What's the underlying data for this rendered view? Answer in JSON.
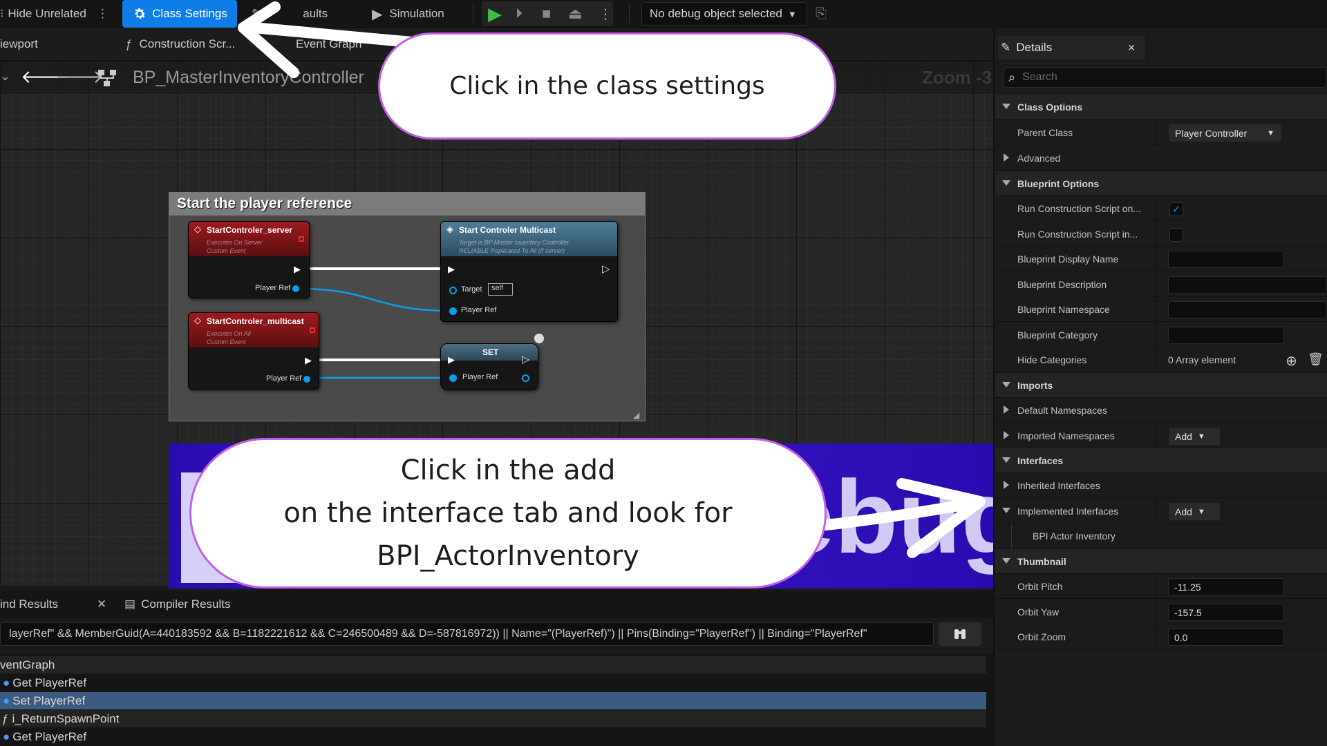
{
  "toolbar": {
    "hide_unrelated": "Hide Unrelated",
    "class_settings": "Class Settings",
    "class_defaults": "aults",
    "simulation": "Simulation",
    "debug_object": "No debug object selected"
  },
  "tabs": {
    "viewport": "iewport",
    "construction_script": "Construction Scr...",
    "event_graph": "Event Graph"
  },
  "graph": {
    "blueprint_name": "BP_MasterInventoryController",
    "zoom": "Zoom -3",
    "comment": "Start the player reference",
    "nodes": {
      "server": {
        "title": "StartControler_server",
        "sub1": "Executes On Server",
        "sub2": "Custom Event",
        "pin": "Player Ref"
      },
      "multicast_event": {
        "title": "StartControler_multicast",
        "sub1": "Executes On All",
        "sub2": "Custom Event",
        "pin": "Player Ref"
      },
      "multicast_call": {
        "title": "Start Controler Multicast",
        "sub1": "Target is BP Master Inventory Controller",
        "sub2": "RELIABLE Replicated To All (if server)",
        "target_label": "Target",
        "target_value": "self",
        "pin": "Player Ref"
      },
      "set": {
        "title": "SET",
        "pin": "Player Ref"
      }
    }
  },
  "callouts": {
    "top": "Click in the class settings",
    "bottom_line1": "Click in the add",
    "bottom_line2": "on the interface tab and look for",
    "bottom_line3": "BPI_ActorInventory"
  },
  "bottom_panel": {
    "find_results": "ind Results",
    "compiler_results": "Compiler Results",
    "search_query": "layerRef\" && MemberGuid(A=440183592 && B=1182221612 && C=246500489 && D=-587816972)) || Name=\"(PlayerRef)\") || Pins(Binding=\"PlayerRef\") || Binding=\"PlayerRef\"",
    "results": [
      {
        "icon": "",
        "label": "ventGraph"
      },
      {
        "icon": "variable-icon",
        "label": "Get PlayerRef"
      },
      {
        "icon": "variable-icon",
        "label": "Set PlayerRef"
      },
      {
        "icon": "function-icon",
        "label": "i_ReturnSpawnPoint"
      },
      {
        "icon": "variable-icon",
        "label": "Get PlayerRef"
      }
    ]
  },
  "details": {
    "tab_label": "Details",
    "search_placeholder": "Search",
    "class_options": "Class Options",
    "parent_class_label": "Parent Class",
    "parent_class_value": "Player Controller",
    "advanced": "Advanced",
    "blueprint_options": "Blueprint Options",
    "run_cs_on_drag": "Run Construction Script on...",
    "run_cs_in_seq": "Run Construction Script in...",
    "bp_display_name": "Blueprint Display Name",
    "bp_description": "Blueprint Description",
    "bp_namespace": "Blueprint Namespace",
    "bp_category": "Blueprint Category",
    "hide_categories": "Hide Categories",
    "hide_categories_value": "0 Array element",
    "imports": "Imports",
    "default_namespaces": "Default Namespaces",
    "imported_namespaces": "Imported Namespaces",
    "add": "Add",
    "interfaces": "Interfaces",
    "inherited_interfaces": "Inherited Interfaces",
    "implemented_interfaces": "Implemented Interfaces",
    "bpi_actor_inventory": "BPI Actor Inventory",
    "thumbnail": "Thumbnail",
    "orbit_pitch": "Orbit Pitch",
    "orbit_pitch_value": "-11.25",
    "orbit_yaw": "Orbit Yaw",
    "orbit_yaw_value": "-157.5",
    "orbit_zoom": "Orbit Zoom",
    "orbit_zoom_value": "0.0"
  }
}
